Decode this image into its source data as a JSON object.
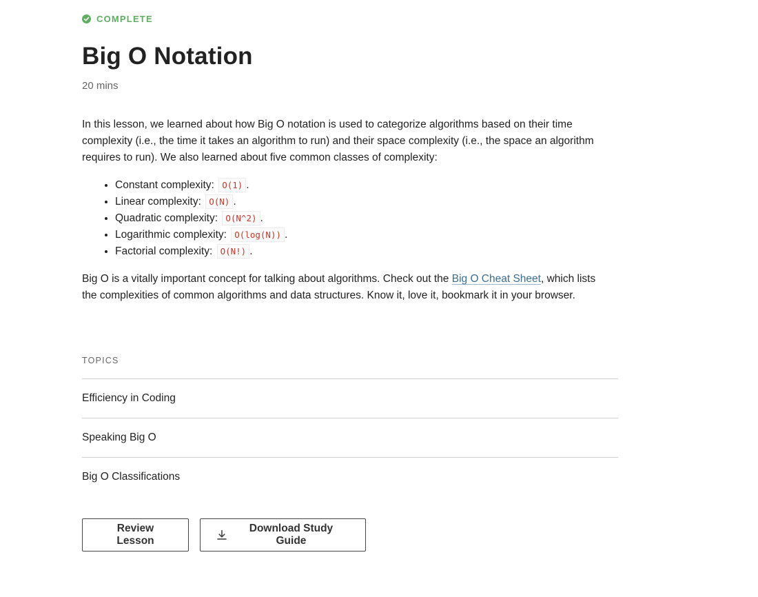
{
  "status": {
    "label": "COMPLETE",
    "icon": "check-circle-icon",
    "color": "#5fae62"
  },
  "lesson": {
    "title": "Big O Notation",
    "duration": "20 mins",
    "intro": "In this lesson, we learned about how Big O notation is used to categorize algorithms based on their time complexity (i.e., the time it takes an algorithm to run) and their space complexity (i.e., the space an algorithm requires to run). We also learned about five common classes of complexity:",
    "complexities": [
      {
        "label": "Constant complexity:",
        "code": "O(1)",
        "suffix": "."
      },
      {
        "label": "Linear complexity:",
        "code": "O(N)",
        "suffix": "."
      },
      {
        "label": "Quadratic complexity:",
        "code": "O(N^2)",
        "suffix": "."
      },
      {
        "label": "Logarithmic complexity:",
        "code": "O(log(N))",
        "suffix": "."
      },
      {
        "label": "Factorial complexity:",
        "code": "O(N!)",
        "suffix": "."
      }
    ],
    "outro_before": "Big O is a vitally important concept for talking about algorithms. Check out the ",
    "outro_link": "Big O Cheat Sheet",
    "outro_after": ", which lists the complexities of common algorithms and data structures. Know it, love it, bookmark it in your browser."
  },
  "topics": {
    "label": "TOPICS",
    "items": [
      "Efficiency in Coding",
      "Speaking Big O",
      "Big O Classifications"
    ]
  },
  "actions": {
    "review_label": "Review Lesson",
    "download_label": "Download Study Guide",
    "download_icon": "download-icon"
  },
  "colors": {
    "code_text": "#c0392b",
    "link": "#3d6e8c"
  }
}
